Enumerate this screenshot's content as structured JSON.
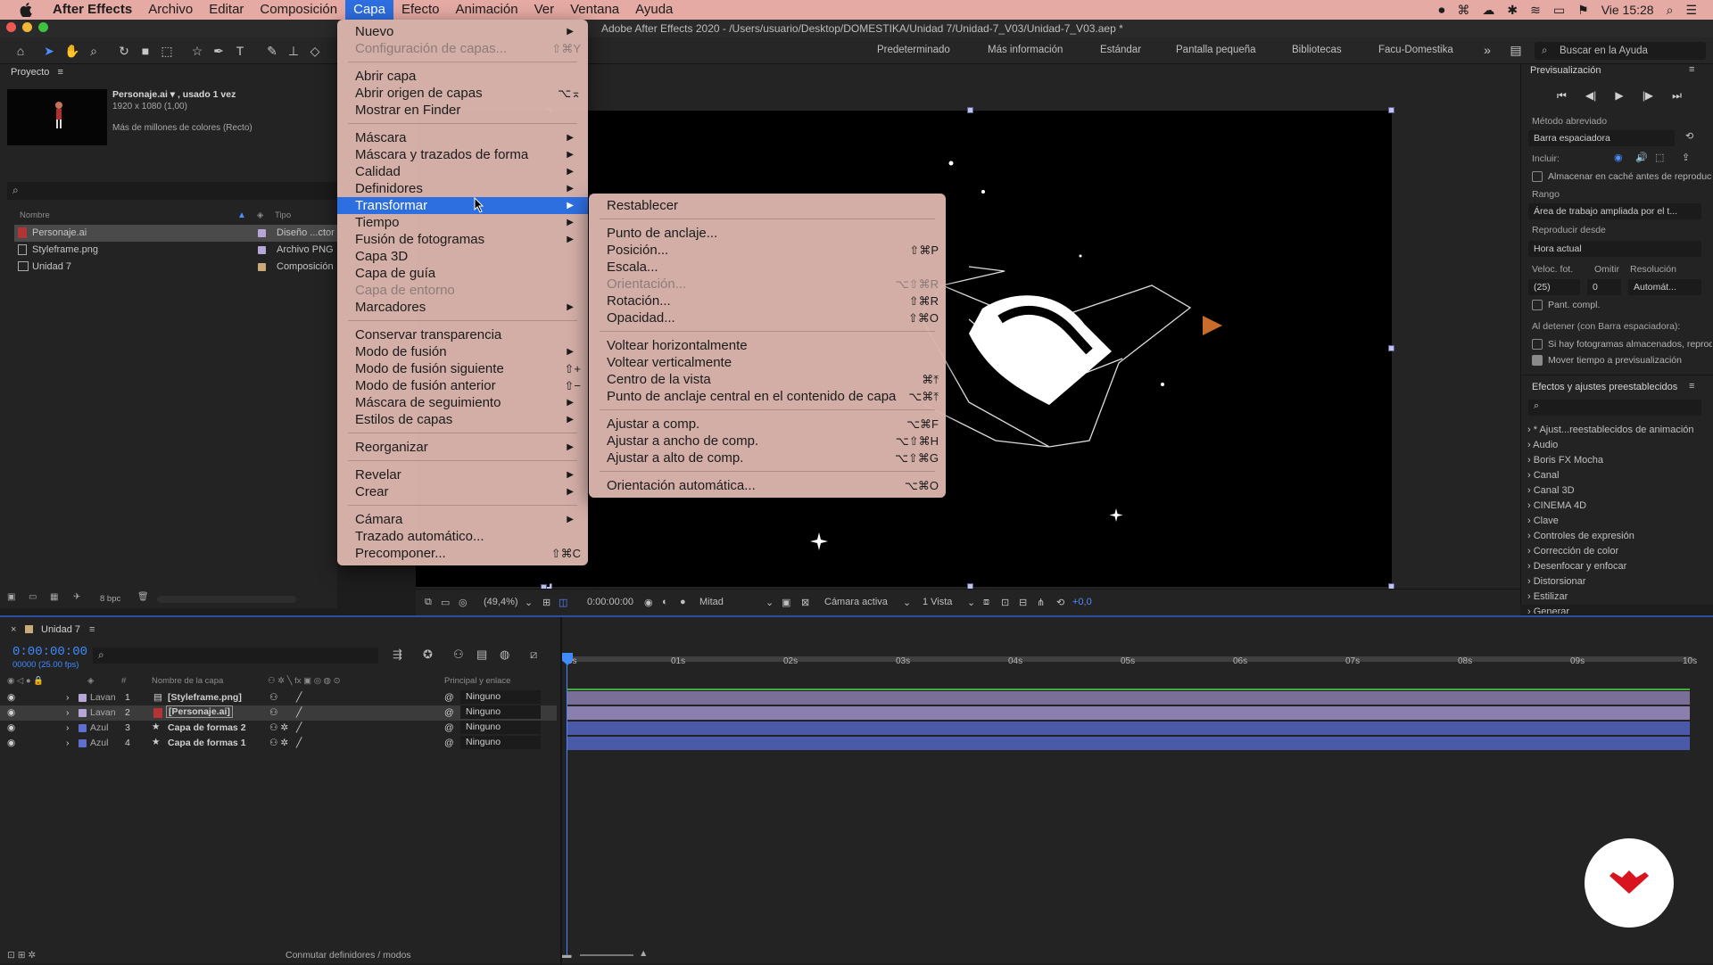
{
  "menubar": {
    "app_name": "After Effects",
    "items": [
      "Archivo",
      "Editar",
      "Composición",
      "Capa",
      "Efecto",
      "Animación",
      "Ver",
      "Ventana",
      "Ayuda"
    ],
    "active_item": "Capa",
    "clock": "Vie 15:28"
  },
  "window": {
    "title": "Adobe After Effects 2020 - /Users/usuario/Desktop/DOMESTIKA/Unidad 7/Unidad-7_V03/Unidad-7_V03.aep *"
  },
  "workspaces": [
    "Predeterminado",
    "Más información",
    "Estándar",
    "Pantalla pequeña",
    "Bibliotecas",
    "Facu-Domestika"
  ],
  "help_search": {
    "placeholder": "Buscar en la Ayuda"
  },
  "project": {
    "title": "Proyecto",
    "selected_name": "Personaje.ai ▾ , usado 1 vez",
    "selected_dims": "1920 x 1080 (1,00)",
    "selected_colors": "Más de millones de colores (Recto)",
    "col_name": "Nombre",
    "col_type": "Tipo",
    "items": [
      {
        "name": "Personaje.ai",
        "type": "Diseño ...ctor",
        "color": "#b7a6d8"
      },
      {
        "name": "Styleframe.png",
        "type": "Archivo PNG",
        "color": "#b7a6d8"
      },
      {
        "name": "Unidad 7",
        "type": "Composición",
        "color": "#c9ab7a"
      }
    ],
    "bpc": "8 bpc"
  },
  "capa_menu": {
    "items": [
      {
        "label": "Nuevo",
        "submenu": true
      },
      {
        "label": "Configuración de capas...",
        "shortcut": "⇧⌘Y",
        "disabled": true
      },
      {
        "label": "Abrir capa"
      },
      {
        "label": "Abrir origen de capas",
        "shortcut": "⌥⌅"
      },
      {
        "label": "Mostrar en Finder"
      },
      {
        "label": "Máscara",
        "submenu": true
      },
      {
        "label": "Máscara y trazados de forma",
        "submenu": true
      },
      {
        "label": "Calidad",
        "submenu": true
      },
      {
        "label": "Definidores",
        "submenu": true
      },
      {
        "label": "Transformar",
        "submenu": true,
        "highlighted": true
      },
      {
        "label": "Tiempo",
        "submenu": true
      },
      {
        "label": "Fusión de fotogramas",
        "submenu": true
      },
      {
        "label": "Capa 3D"
      },
      {
        "label": "Capa de guía"
      },
      {
        "label": "Capa de entorno",
        "disabled": true
      },
      {
        "label": "Marcadores",
        "submenu": true
      },
      {
        "label": "Conservar transparencia"
      },
      {
        "label": "Modo de fusión",
        "submenu": true
      },
      {
        "label": "Modo de fusión siguiente",
        "shortcut": "⇧+"
      },
      {
        "label": "Modo de fusión anterior",
        "shortcut": "⇧−"
      },
      {
        "label": "Máscara de seguimiento",
        "submenu": true
      },
      {
        "label": "Estilos de capas",
        "submenu": true
      },
      {
        "label": "Reorganizar",
        "submenu": true
      },
      {
        "label": "Revelar",
        "submenu": true
      },
      {
        "label": "Crear",
        "submenu": true
      },
      {
        "label": "Cámara",
        "submenu": true
      },
      {
        "label": "Trazado automático..."
      },
      {
        "label": "Precomponer...",
        "shortcut": "⇧⌘C"
      }
    ]
  },
  "transform_menu": {
    "items": [
      {
        "label": "Restablecer"
      },
      {
        "label": "Punto de anclaje..."
      },
      {
        "label": "Posición...",
        "shortcut": "⇧⌘P"
      },
      {
        "label": "Escala..."
      },
      {
        "label": "Orientación...",
        "shortcut": "⌥⇧⌘R",
        "disabled": true
      },
      {
        "label": "Rotación...",
        "shortcut": "⇧⌘R"
      },
      {
        "label": "Opacidad...",
        "shortcut": "⇧⌘O"
      },
      {
        "label": "Voltear horizontalmente"
      },
      {
        "label": "Voltear verticalmente"
      },
      {
        "label": "Centro de la vista",
        "shortcut": "⌘⤒"
      },
      {
        "label": "Punto de anclaje central en el contenido de capa",
        "shortcut": "⌥⌘⤒"
      },
      {
        "label": "Ajustar a comp.",
        "shortcut": "⌥⌘F"
      },
      {
        "label": "Ajustar a ancho de comp.",
        "shortcut": "⌥⇧⌘H"
      },
      {
        "label": "Ajustar a alto de comp.",
        "shortcut": "⌥⇧⌘G"
      },
      {
        "label": "Orientación automática...",
        "shortcut": "⌥⌘O"
      }
    ]
  },
  "viewer": {
    "zoom": "(49,4%)",
    "time": "0:00:00:00",
    "resolution": "Mitad",
    "camera": "Cámara activa",
    "views": "1 Vista",
    "exposure": "+0,0"
  },
  "preview": {
    "title": "Previsualización",
    "shortcut_label": "Método abreviado",
    "shortcut_value": "Barra espaciadora",
    "include_label": "Incluir:",
    "cache_label": "Almacenar en caché antes de reproducir",
    "range_label": "Rango",
    "range_value": "Área de trabajo ampliada por el t...",
    "play_from_label": "Reproducir desde",
    "play_from_value": "Hora actual",
    "fps_label": "Veloc. fot.",
    "skip_label": "Omitir",
    "res_label": "Resolución",
    "fps_value": "(25)",
    "skip_value": "0",
    "res_value": "Automát...",
    "fullscreen_label": "Pant. compl.",
    "on_stop_label": "Al detener (con Barra espaciadora):",
    "cached_label": "Si hay fotogramas almacenados, reproducir",
    "move_time_label": "Mover tiempo a previsualización"
  },
  "effects": {
    "title": "Efectos y ajustes preestablecidos",
    "items": [
      "* Ajust...reestablecidos de animación",
      "Audio",
      "Boris FX Mocha",
      "Canal",
      "Canal 3D",
      "CINEMA 4D",
      "Clave",
      "Controles de expresión",
      "Corrección de color",
      "Desenfocar y enfocar",
      "Distorsionar",
      "Estilizar",
      "Generar"
    ]
  },
  "timeline": {
    "comp_name": "Unidad 7",
    "timecode": "0:00:00:00",
    "fps": "00000 (25.00 fps)",
    "col_layer_name": "Nombre de la capa",
    "col_parent": "Principal y enlace",
    "ruler": [
      "0s",
      "01s",
      "02s",
      "03s",
      "04s",
      "05s",
      "06s",
      "07s",
      "08s",
      "09s",
      "10s"
    ],
    "layers": [
      {
        "label": "Lavan",
        "num": "1",
        "name": "[Styleframe.png]",
        "parent": "Ninguno",
        "color": "#b7a6d8",
        "bar_color": "#7a6f99"
      },
      {
        "label": "Lavan",
        "num": "2",
        "name": "[Personaje.ai]",
        "parent": "Ninguno",
        "color": "#b7a6d8",
        "bar_color": "#7a6f99"
      },
      {
        "label": "Azul",
        "num": "3",
        "name": "Capa de formas 2",
        "parent": "Ninguno",
        "color": "#5e6fd1",
        "bar_color": "#4b5aa8"
      },
      {
        "label": "Azul",
        "num": "4",
        "name": "Capa de formas 1",
        "parent": "Ninguno",
        "color": "#5e6fd1",
        "bar_color": "#4b5aa8"
      }
    ],
    "footer_toggle": "Conmutar definidores / modos"
  }
}
